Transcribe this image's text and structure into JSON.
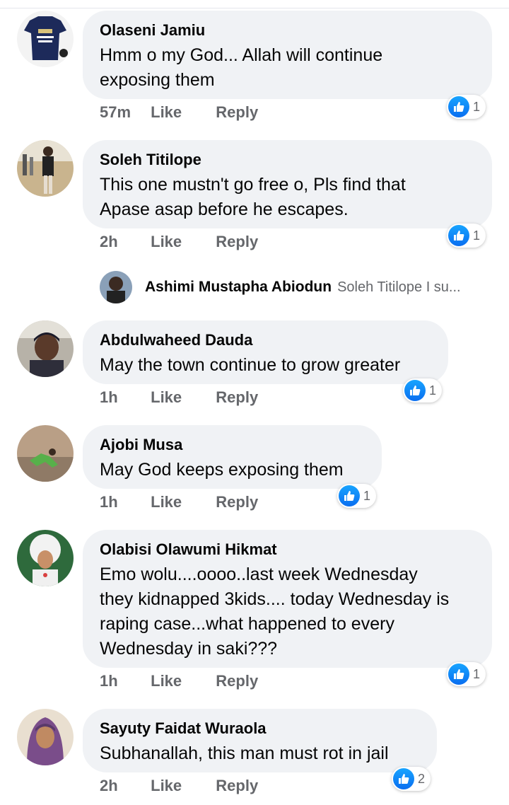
{
  "comments": [
    {
      "name": "Olaseni Jamiu",
      "lines": [
        "Hmm o my God... Allah will continue",
        "exposing them"
      ],
      "time": "57m",
      "like": "Like",
      "reply": "Reply",
      "reactions": "1"
    },
    {
      "name": "Soleh Titilope",
      "lines": [
        "This one mustn't go free o, Pls find that",
        "Apase asap before he escapes."
      ],
      "time": "2h",
      "like": "Like",
      "reply": "Reply",
      "reactions": "1"
    },
    {
      "name": "Abdulwaheed Dauda",
      "lines": [
        "May the town continue to grow greater"
      ],
      "time": "1h",
      "like": "Like",
      "reply": "Reply",
      "reactions": "1"
    },
    {
      "name": "Ajobi Musa",
      "lines": [
        "May God keeps exposing them"
      ],
      "time": "1h",
      "like": "Like",
      "reply": "Reply",
      "reactions": "1"
    },
    {
      "name": "Olabisi Olawumi Hikmat",
      "lines": [
        "Emo wolu....oooo..last week Wednesday",
        "they kidnapped 3kids.... today Wednesday is",
        "raping case...what happened to every",
        "Wednesday in saki???"
      ],
      "time": "1h",
      "like": "Like",
      "reply": "Reply",
      "reactions": "1"
    },
    {
      "name": "Sayuty Faidat Wuraola",
      "lines": [
        "Subhanallah, this man must rot in jail"
      ],
      "time": "2h",
      "like": "Like",
      "reply": "Reply",
      "reactions": "2"
    }
  ],
  "reply_preview": {
    "name": "Ashimi Mustapha Abiodun",
    "snippet": "Soleh Titilope I su..."
  },
  "colors": {
    "bubble": "#f0f2f5",
    "meta": "#65676b",
    "text": "#050505",
    "like_blue": "#1877f2"
  }
}
